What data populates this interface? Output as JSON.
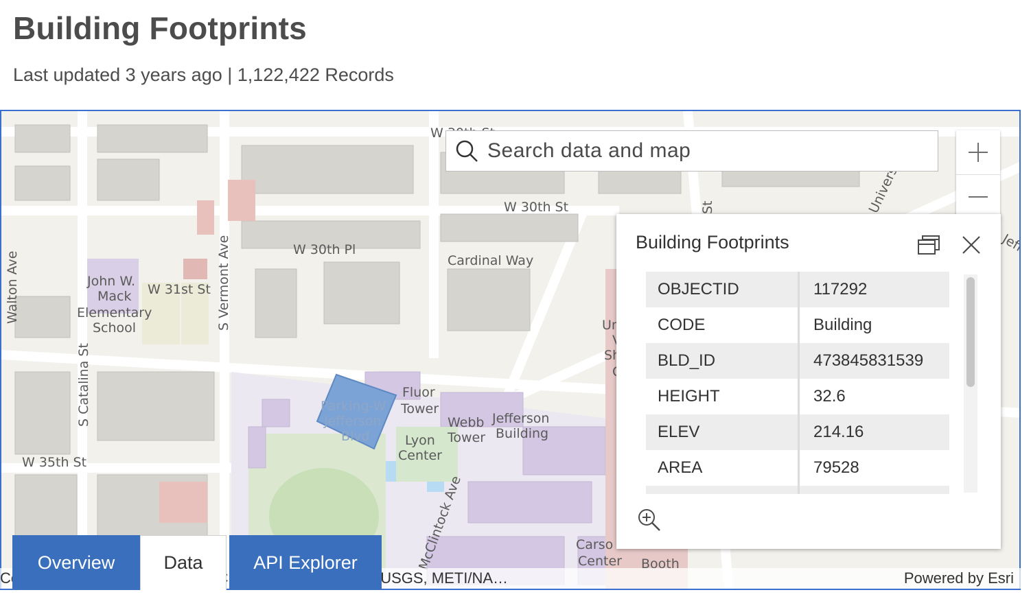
{
  "header": {
    "title": "Building Footprints",
    "subtitle": "Last updated 3 years ago | 1,122,422 Records"
  },
  "map": {
    "search_placeholder": "Search data and map",
    "zoom_in_label": "+",
    "zoom_out_label": "—",
    "labels": {
      "w30st_top": "W 30th St",
      "w30st": "W 30th St",
      "w30pl": "W 30th Pl",
      "cardinal_way": "Cardinal Way",
      "w31st": "W 31st St",
      "vermont": "S Vermont Ave",
      "walton": "Walton Ave",
      "catalina": "S Catalina St",
      "w35st": "W 35th St",
      "mack1": "John W.",
      "mack2": "Mack",
      "mack3": "Elementary",
      "mack4": "School",
      "fluor1": "Fluor",
      "fluor2": "Tower",
      "parking1": "Parking-W",
      "parking2": "Jefferson",
      "parking3": "Blvd",
      "webb1": "Webb",
      "webb2": "Tower",
      "jefferson1": "Jefferson",
      "jefferson2": "Building",
      "lyon1": "Lyon",
      "lyon2": "Center",
      "mcclintock": "McClintock Ave",
      "carson1": "Carso",
      "carson2": "Center",
      "booth": "Booth",
      "university": "Univers",
      "st": "St",
      "un": "Un",
      "v": "V",
      "sh": "Sh",
      "c": "C",
      "jeff_edge": "Jeff"
    },
    "attribution": "Co… nt, Esri, HERE, Garmin, INCREMENT P, Intermap, USGS, METI/NA…",
    "powered_by": "Powered by Esri"
  },
  "popup": {
    "title": "Building Footprints",
    "rows": [
      {
        "key": "OBJECTID",
        "value": "117292"
      },
      {
        "key": "CODE",
        "value": "Building"
      },
      {
        "key": "BLD_ID",
        "value": "473845831539"
      },
      {
        "key": "HEIGHT",
        "value": "32.6"
      },
      {
        "key": "ELEV",
        "value": "214.16"
      },
      {
        "key": "AREA",
        "value": "79528"
      }
    ]
  },
  "tabs": [
    {
      "label": "Overview",
      "active": false
    },
    {
      "label": "Data",
      "active": true
    },
    {
      "label": "API Explorer",
      "active": false
    }
  ],
  "colors": {
    "accent": "#3a6fbd",
    "map_border": "#3a6fd0",
    "selected_feature": "#7ba3d6"
  }
}
